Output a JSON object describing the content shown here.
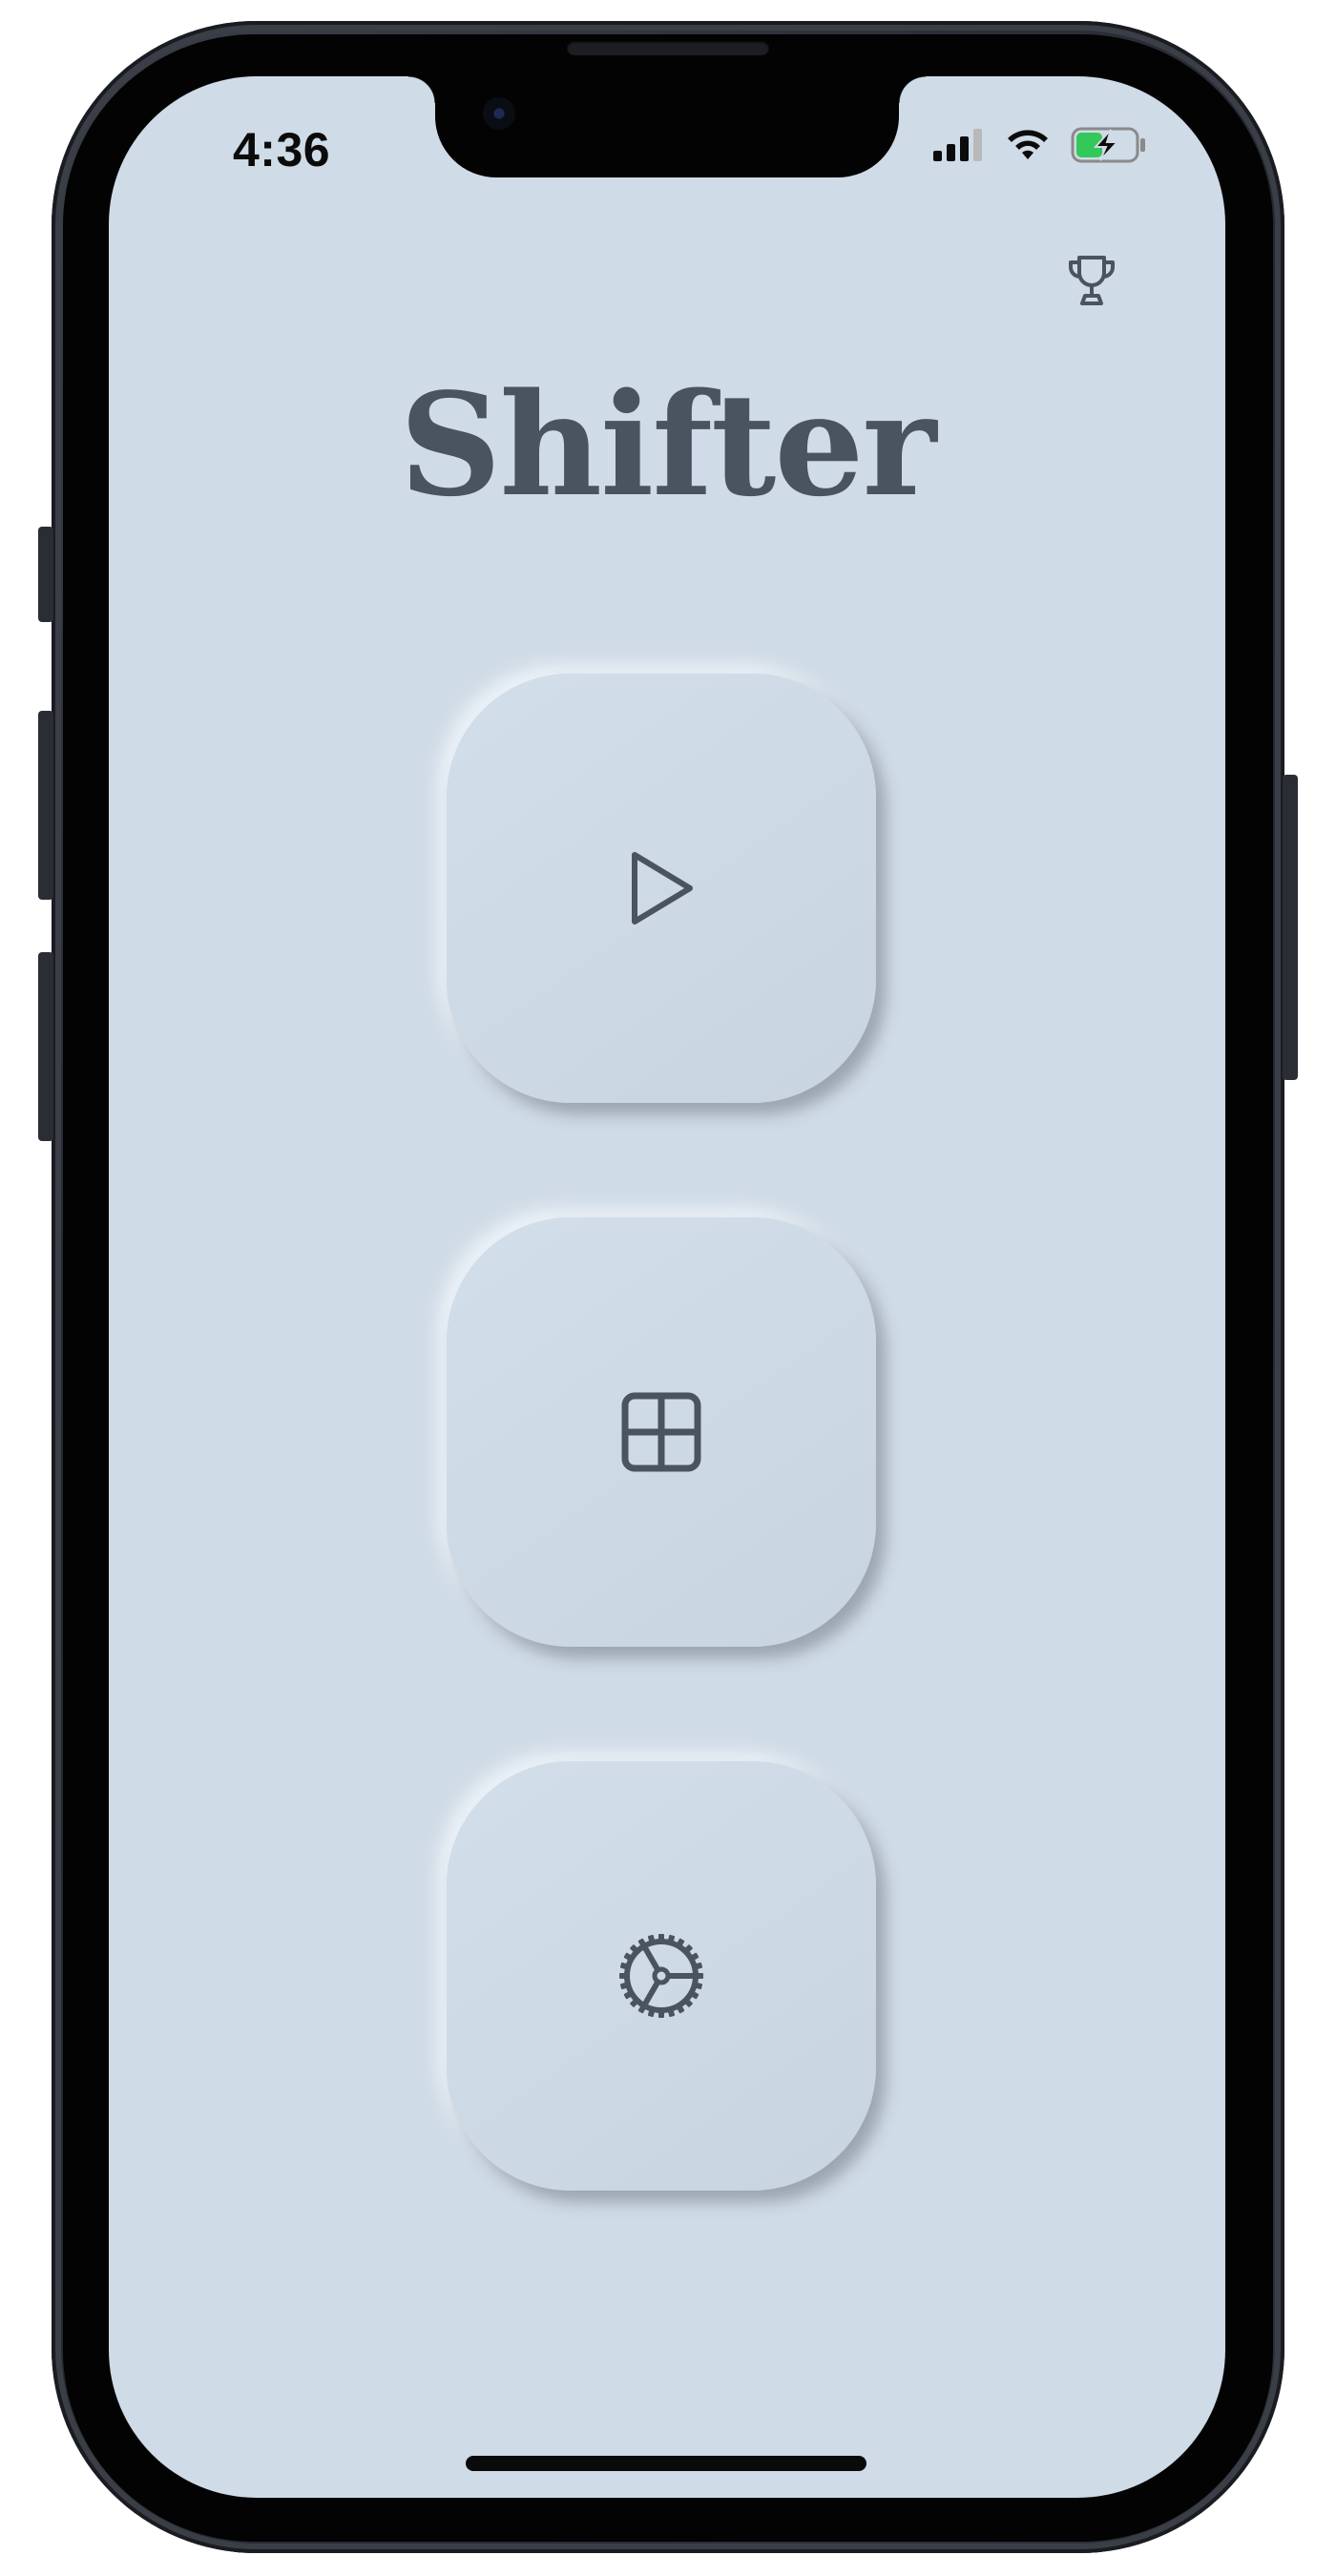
{
  "status_bar": {
    "time": "4:36",
    "cell_signal_bars": 3,
    "cell_signal_max": 4,
    "battery_level": 0.45,
    "battery_charging": true,
    "battery_color": "#34c759"
  },
  "header": {
    "title": "Shifter",
    "trophy_icon": "trophy-icon"
  },
  "menu": {
    "buttons": [
      {
        "id": "play",
        "icon": "play-icon"
      },
      {
        "id": "grid",
        "icon": "grid-icon"
      },
      {
        "id": "settings",
        "icon": "gear-icon"
      }
    ]
  },
  "colors": {
    "background": "#cfdbe6",
    "text": "#4a5360",
    "icon": "#4a5360",
    "device_frame": "#2c3038"
  }
}
